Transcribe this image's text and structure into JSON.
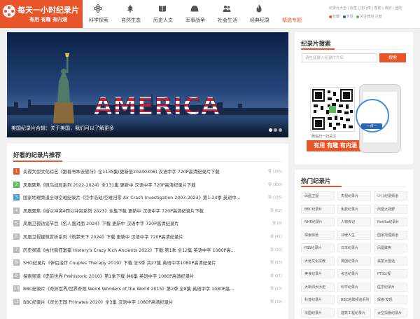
{
  "logo": {
    "title": "每天一小时纪录片",
    "slogan": "有用 有趣 有内涵"
  },
  "nav": [
    {
      "label": "科学探索",
      "icon": "atom-icon"
    },
    {
      "label": "自然生态",
      "icon": "tree-icon"
    },
    {
      "label": "历史人文",
      "icon": "book-icon"
    },
    {
      "label": "军事战争",
      "icon": "helmet-icon"
    },
    {
      "label": "社会生活",
      "icon": "people-icon"
    },
    {
      "label": "经典纪录",
      "icon": "flame-icon"
    },
    {
      "label": "精选专题",
      "icon": "none"
    }
  ],
  "top_links": {
    "line1": "纪录片大全 | 标签 | 排行榜 | 帮助 | 我的 | 登陆",
    "line2_new": "收藏",
    "line2_hot": "专题",
    "line2_follow": "关注微信 注册"
  },
  "banner": {
    "word": "AMERICA",
    "caption": "美国纪录片合辑：关于美国，我们可以了解更多"
  },
  "list": {
    "title": "好看的纪录片推荐",
    "items": [
      {
        "num": "1",
        "title": "央视大型文化综艺《跟着书本去旅行》全1135集(更新至20240308) 汉语中字 720P高清纪录片下载",
        "count": "赞 (286)",
        "color": "#e8552b"
      },
      {
        "num": "2",
        "title": "凤凰聚焦《佩乌战局系列 2022-2024》全131集 更新中 汉语中字 720P高清纪录片下载",
        "count": "赞 (100)",
        "color": "#5cb85c"
      },
      {
        "num": "3",
        "title": "国家地理频道全球空难纪录片《空中浩劫/空难归零 Air Crash Investigation 2003-2023》第1-24季 英语中...",
        "count": "赞 (193)",
        "color": "#4a9fd6"
      },
      {
        "num": "4",
        "title": "凤凰聚焦《给以冲突4四以冲突系列 2023》全集下载 更新中 汉语中字 720P高清纪录片下载",
        "count": "赞 (62)",
        "color": "#bbbbbb"
      },
      {
        "num": "5",
        "title": "凤凰卫视访谈节目《名人面对面 2024》下载 更新中 汉语中字 720P高清纪录片",
        "count": "赞 (8)",
        "color": "#bbbbbb"
      },
      {
        "num": "6",
        "title": "凤凰卫视建筑赏析系列《筑梦天下 2024》下载 更新中 汉语中字 720P高清纪录片",
        "count": "赞 (41)",
        "color": "#bbbbbb"
      },
      {
        "num": "7",
        "title": "历史频道《古代疯狂富豪 History's Crazy Rich Ancients 2022》下载 第1季 全12集 英语中字 1080P高...",
        "count": "赞 (30)",
        "color": "#bbbbbb"
      },
      {
        "num": "8",
        "title": "SHO纪录片《伴侣治疗 Couples Therapy 2019》下载 全3季 共27集 英语中字1080P高清纪录片",
        "count": "赞 (55)",
        "color": "#bbbbbb"
      },
      {
        "num": "9",
        "title": "探索频道《史前世界 Prehistoric 2010》第1季下载 共6集 英语中字 1080P高清纪录片",
        "count": "赞 (21)",
        "color": "#bbbbbb"
      },
      {
        "num": "10",
        "title": "BBC纪录片《奇异世界/世界奇观 Weird Wonders of the World 2015》第2季 全8集 英语中字 1080P高...",
        "count": "赞 (23)",
        "color": "#bbbbbb"
      },
      {
        "num": "11",
        "title": "BBC纪录片《灵长王国 Primates 2020》全3集 汉语中字 1080P高清纪录片",
        "count": "赞 (39)",
        "color": "#bbbbbb"
      }
    ]
  },
  "search": {
    "title": "纪录片搜索",
    "placeholder": "请在此输入纪录片片名",
    "button": "搜索"
  },
  "wechat": {
    "caption": "微信扫一扫关注",
    "slogan": "有用 有趣 有内涵",
    "phone_label": "一点一"
  },
  "hot_tags": {
    "title": "热门纪录片",
    "items": [
      "凤凰卫视",
      "央视纪录片",
      "少儿纪录频道",
      "BBC纪录片",
      "免费纪录片",
      "凤凰大视野",
      "NHK纪录片",
      "人物传记",
      "Netflix纪录片",
      "探索频道",
      "冷暖人生",
      "国家地理频道",
      "PBS纪录片",
      "日本纪录片",
      "凤凰聚焦",
      "大道文化宗教",
      "英国纪录片",
      "美丽大国话",
      "美食纪录片",
      "考古纪录片",
      "PTS公视",
      "大新闻大历史",
      "科学纪录片",
      "医学纪录片",
      "科普纪录片",
      "BBC地球频道系列",
      "探索·发现",
      "法国纪录片",
      "建筑工程纪录片",
      "太空探索纪录片"
    ]
  },
  "colors": {
    "accent": "#e8552b",
    "link": "#2a67b0"
  }
}
